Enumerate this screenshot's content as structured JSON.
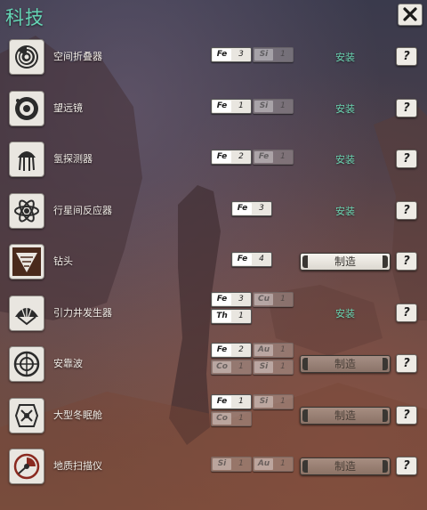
{
  "title": "科技",
  "close_icon": "close-x-icon",
  "help_label": "?",
  "rows": [
    {
      "name": "空间折叠器",
      "icon": "spiral-vortex-icon",
      "resources": [
        {
          "sym": "Fe",
          "count": "3",
          "dim": false
        },
        {
          "sym": "Si",
          "count": "1",
          "dim": true
        }
      ],
      "action": {
        "type": "install",
        "label": "安装"
      }
    },
    {
      "name": "望远镜",
      "icon": "telescope-lens-icon",
      "resources": [
        {
          "sym": "Fe",
          "count": "1",
          "dim": false
        },
        {
          "sym": "Si",
          "count": "1",
          "dim": true
        }
      ],
      "action": {
        "type": "install",
        "label": "安装"
      }
    },
    {
      "name": "氢探测器",
      "icon": "jellyfish-probe-icon",
      "resources": [
        {
          "sym": "Fe",
          "count": "2",
          "dim": false
        },
        {
          "sym": "Fe",
          "count": "1",
          "dim": true
        }
      ],
      "action": {
        "type": "install",
        "label": "安装"
      }
    },
    {
      "name": "行星间反应器",
      "icon": "atom-icon",
      "resources": [
        {
          "sym": "Fe",
          "count": "3",
          "dim": false
        }
      ],
      "action": {
        "type": "install",
        "label": "安装"
      }
    },
    {
      "name": "钻头",
      "icon": "drill-icon",
      "resources": [
        {
          "sym": "Fe",
          "count": "4",
          "dim": false
        }
      ],
      "action": {
        "type": "craft",
        "label": "制造",
        "enabled": true
      }
    },
    {
      "name": "引力井发生器",
      "icon": "gravity-fan-icon",
      "resources": [
        {
          "sym": "Fe",
          "count": "3",
          "dim": false
        },
        {
          "sym": "Cu",
          "count": "1",
          "dim": true
        },
        {
          "sym": "Th",
          "count": "1",
          "dim": false
        }
      ],
      "action": {
        "type": "install",
        "label": "安装"
      }
    },
    {
      "name": "安靠波",
      "icon": "target-ring-icon",
      "resources": [
        {
          "sym": "Fe",
          "count": "2",
          "dim": false
        },
        {
          "sym": "Au",
          "count": "1",
          "dim": true
        },
        {
          "sym": "Co",
          "count": "1",
          "dim": true
        },
        {
          "sym": "Si",
          "count": "1",
          "dim": true
        }
      ],
      "action": {
        "type": "craft",
        "label": "制造",
        "enabled": false
      }
    },
    {
      "name": "大型冬眠舱",
      "icon": "cryo-pod-icon",
      "resources": [
        {
          "sym": "Fe",
          "count": "1",
          "dim": false
        },
        {
          "sym": "Si",
          "count": "1",
          "dim": true
        },
        {
          "sym": "Co",
          "count": "1",
          "dim": true
        }
      ],
      "action": {
        "type": "craft",
        "label": "制造",
        "enabled": false
      }
    },
    {
      "name": "地质扫描仪",
      "icon": "geo-scanner-icon",
      "resources": [
        {
          "sym": "Si",
          "count": "1",
          "dim": true
        },
        {
          "sym": "Au",
          "count": "1",
          "dim": true
        }
      ],
      "action": {
        "type": "craft",
        "label": "制造",
        "enabled": false
      }
    }
  ]
}
